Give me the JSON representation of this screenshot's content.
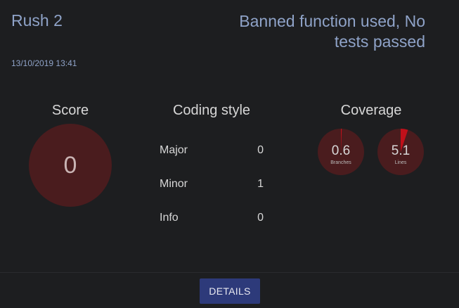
{
  "header": {
    "title": "Rush 2",
    "status": "Banned function used, No tests passed",
    "date": "13/10/2019 13:41"
  },
  "score": {
    "title": "Score",
    "value": "0"
  },
  "coding_style": {
    "title": "Coding style",
    "rows": [
      {
        "label": "Major",
        "value": "0"
      },
      {
        "label": "Minor",
        "value": "1"
      },
      {
        "label": "Info",
        "value": "0"
      }
    ]
  },
  "coverage": {
    "title": "Coverage",
    "branches": {
      "value": "0.6",
      "label": "Branches",
      "percent": 0.6
    },
    "lines": {
      "value": "5.1",
      "label": "Lines",
      "percent": 5.1
    }
  },
  "actions": {
    "details_label": "DETAILS"
  },
  "colors": {
    "accent_text": "#8fa3c8",
    "circle_bg": "#4a1c1e",
    "coverage_fill": "#c0101a",
    "button_bg": "#2d3a7a"
  }
}
